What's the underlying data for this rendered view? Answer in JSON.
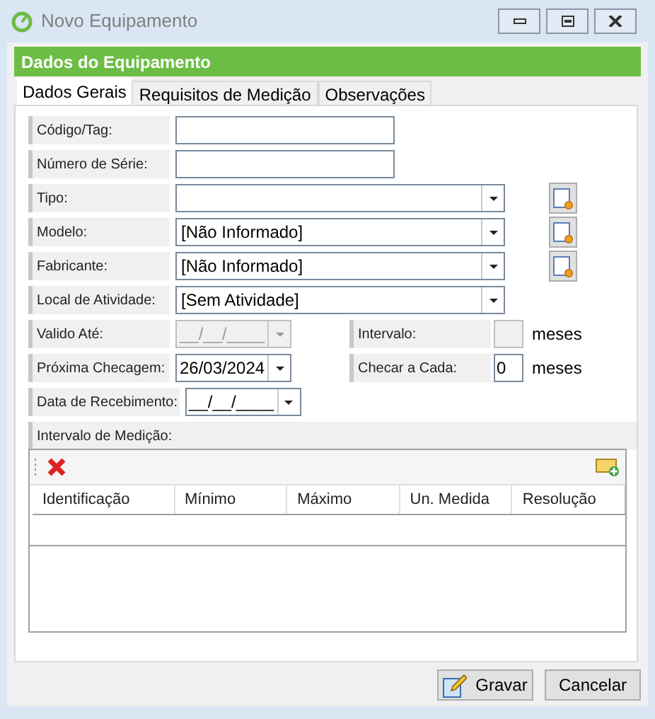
{
  "window": {
    "title": "Novo Equipamento"
  },
  "section_title": "Dados do Equipamento",
  "tabs": [
    {
      "label": "Dados Gerais",
      "selected": true
    },
    {
      "label": "Requisitos de Medição",
      "selected": false
    },
    {
      "label": "Observações",
      "selected": false
    }
  ],
  "fields": [
    {
      "label": "Código/Tag:",
      "kind": "text"
    },
    {
      "label": "Número de Série:",
      "kind": "text"
    },
    {
      "label": "Tipo:",
      "kind": "combo",
      "add_button": true
    },
    {
      "label": "Modelo:",
      "kind": "combo",
      "value": "[Não Informado]",
      "add_button": true
    },
    {
      "label": "Fabricante:",
      "kind": "combo",
      "value": "[Não Informado]",
      "add_button": true
    },
    {
      "label": "Local de Atividade:",
      "kind": "combo",
      "value": "[Sem Atividade]",
      "add_button": false
    },
    {
      "label": "Valido Até:",
      "kind": "date",
      "value": "__/__/____",
      "disabled": true,
      "side": {
        "label": "Intervalo:",
        "unit": "meses",
        "disabled": true
      }
    },
    {
      "label": "Próxima Checagem:",
      "kind": "date",
      "value": "26/03/2024",
      "disabled": false,
      "side": {
        "label": "Checar a Cada:",
        "value": "0",
        "unit": "meses",
        "disabled": false
      }
    },
    {
      "label": "Data de Recebimento:",
      "kind": "date",
      "value": "__/__/____",
      "disabled": false
    }
  ],
  "measurement": {
    "label": "Intervalo de Medição:",
    "columns": [
      "Identificação",
      "Mínimo",
      "Máximo",
      "Un. Medida",
      "Resolução"
    ]
  },
  "buttons": [
    {
      "label": "Gravar",
      "kind": "save"
    },
    {
      "label": "Cancelar",
      "kind": "cancel"
    }
  ]
}
